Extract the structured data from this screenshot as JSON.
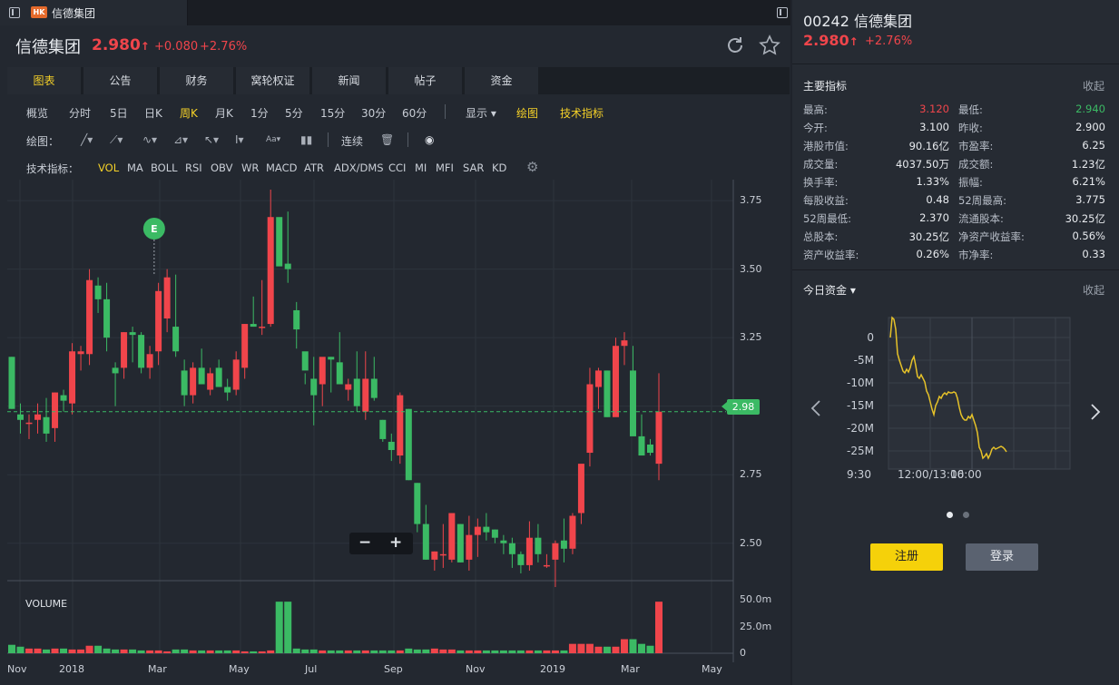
{
  "tab": {
    "badge": "HK",
    "title": "信德集团"
  },
  "header": {
    "name": "信德集团",
    "price": "2.980",
    "arrow": "↑",
    "change": "+0.080",
    "pct": "+2.76%"
  },
  "nav": [
    "图表",
    "公告",
    "财务",
    "窝轮权证",
    "新闻",
    "帖子",
    "资金"
  ],
  "periods": [
    "概览",
    "分时",
    "5日",
    "日K",
    "周K",
    "月K",
    "1分",
    "5分",
    "15分",
    "30分",
    "60分"
  ],
  "period_active": "周K",
  "display_menu": "显示",
  "draw_label": "绘图",
  "tech_label": "技术指标",
  "draw_row": {
    "label": "绘图：",
    "continuous": "连续"
  },
  "indicators_label": "技术指标：",
  "indicators": [
    "VOL",
    "MA",
    "BOLL",
    "RSI",
    "OBV",
    "WR",
    "MACD",
    "ATR",
    "ADX/DMS",
    "CCI",
    "MI",
    "MFI",
    "SAR",
    "KD"
  ],
  "event_marker": "E",
  "last_price_tag": "2.98",
  "volume_label": "VOLUME",
  "chart_data": {
    "type": "candlestick",
    "price_axis": {
      "ticks": [
        "3.75",
        "3.50",
        "3.25",
        "3.00",
        "2.75",
        "2.50"
      ],
      "ylim": [
        2.37,
        3.8
      ]
    },
    "volume_axis": {
      "ticks": [
        "50.0m",
        "25.0m",
        "0"
      ]
    },
    "x_ticks": [
      "Nov",
      "2018",
      "Mar",
      "May",
      "Jul",
      "Sep",
      "Nov",
      "2019",
      "Mar",
      "May"
    ],
    "last_price": 2.98,
    "candles": [
      [
        3.18,
        3.18,
        2.99,
        2.99
      ],
      [
        2.97,
        3.01,
        2.9,
        2.95
      ],
      [
        2.94,
        2.97,
        2.88,
        2.94
      ],
      [
        2.95,
        3.01,
        2.9,
        2.97
      ],
      [
        2.96,
        3.03,
        2.87,
        2.9
      ],
      [
        2.92,
        3.05,
        2.87,
        3.05
      ],
      [
        3.04,
        3.06,
        2.98,
        3.02
      ],
      [
        3.01,
        3.23,
        2.97,
        3.2
      ],
      [
        3.19,
        3.22,
        3.13,
        3.2
      ],
      [
        3.19,
        3.5,
        3.15,
        3.46
      ],
      [
        3.44,
        3.47,
        3.34,
        3.39
      ],
      [
        3.39,
        3.45,
        3.2,
        3.25
      ],
      [
        3.14,
        3.16,
        3.0,
        3.12
      ],
      [
        3.14,
        3.27,
        3.1,
        3.27
      ],
      [
        3.27,
        3.29,
        3.16,
        3.26
      ],
      [
        3.26,
        3.27,
        3.12,
        3.14
      ],
      [
        3.14,
        3.22,
        3.1,
        3.19
      ],
      [
        3.2,
        3.45,
        3.15,
        3.42
      ],
      [
        3.32,
        3.5,
        3.27,
        3.47
      ],
      [
        3.29,
        3.48,
        3.18,
        3.2
      ],
      [
        3.13,
        3.17,
        3.0,
        3.04
      ],
      [
        3.04,
        3.16,
        3.01,
        3.14
      ],
      [
        3.14,
        3.21,
        3.09,
        3.08
      ],
      [
        3.06,
        3.14,
        3.04,
        3.12
      ],
      [
        3.14,
        3.17,
        3.07,
        3.07
      ],
      [
        3.07,
        3.1,
        3.02,
        3.05
      ],
      [
        3.06,
        3.2,
        3.04,
        3.17
      ],
      [
        3.14,
        3.3,
        3.1,
        3.3
      ],
      [
        3.3,
        3.4,
        3.29,
        3.29
      ],
      [
        3.29,
        3.46,
        3.26,
        3.29
      ],
      [
        3.3,
        3.79,
        3.29,
        3.69
      ],
      [
        3.69,
        3.68,
        3.55,
        3.51
      ],
      [
        3.52,
        3.71,
        3.45,
        3.5
      ],
      [
        3.35,
        3.38,
        3.21,
        3.28
      ],
      [
        3.2,
        3.12,
        3.08,
        3.13
      ],
      [
        3.1,
        3.18,
        2.93,
        3.04
      ],
      [
        3.08,
        3.15,
        3.0,
        3.18
      ],
      [
        3.18,
        3.18,
        3.05,
        3.17
      ],
      [
        3.16,
        3.27,
        3.15,
        3.08
      ],
      [
        3.06,
        3.1,
        3.02,
        3.08
      ],
      [
        3.1,
        3.2,
        2.98,
        3.0
      ],
      [
        2.98,
        3.2,
        2.95,
        3.1
      ],
      [
        3.1,
        3.18,
        3.02,
        3.03
      ],
      [
        2.95,
        2.95,
        2.87,
        2.88
      ],
      [
        2.87,
        2.9,
        2.8,
        2.84
      ],
      [
        2.82,
        3.05,
        2.79,
        3.04
      ],
      [
        2.99,
        2.99,
        2.73,
        2.73
      ],
      [
        2.72,
        2.72,
        2.54,
        2.57
      ],
      [
        2.57,
        2.64,
        2.44,
        2.44
      ],
      [
        2.44,
        2.47,
        2.4,
        2.47
      ],
      [
        2.46,
        2.57,
        2.41,
        2.46
      ],
      [
        2.44,
        2.6,
        2.43,
        2.61
      ],
      [
        2.57,
        2.57,
        2.43,
        2.43
      ],
      [
        2.44,
        2.6,
        2.4,
        2.53
      ],
      [
        2.53,
        2.59,
        2.45,
        2.56
      ],
      [
        2.56,
        2.61,
        2.51,
        2.54
      ],
      [
        2.55,
        2.55,
        2.5,
        2.52
      ],
      [
        2.51,
        2.53,
        2.46,
        2.5
      ],
      [
        2.5,
        2.52,
        2.41,
        2.46
      ],
      [
        2.46,
        2.47,
        2.39,
        2.42
      ],
      [
        2.42,
        2.58,
        2.4,
        2.52
      ],
      [
        2.52,
        2.57,
        2.43,
        2.46
      ],
      [
        2.42,
        2.46,
        2.41,
        2.42
      ],
      [
        2.44,
        2.51,
        2.34,
        2.5
      ],
      [
        2.51,
        2.59,
        2.43,
        2.48
      ],
      [
        2.48,
        2.61,
        2.46,
        2.6
      ],
      [
        2.61,
        2.75,
        2.57,
        2.79
      ],
      [
        2.83,
        3.14,
        2.78,
        3.08
      ],
      [
        3.07,
        3.14,
        2.99,
        3.13
      ],
      [
        3.13,
        3.13,
        2.96,
        2.96
      ],
      [
        2.96,
        3.25,
        2.98,
        3.22
      ],
      [
        3.22,
        3.27,
        3.15,
        3.24
      ],
      [
        3.13,
        3.22,
        3.05,
        2.89
      ],
      [
        2.89,
        2.97,
        2.83,
        2.82
      ],
      [
        2.86,
        2.88,
        2.82,
        2.83
      ],
      [
        2.79,
        3.12,
        2.73,
        2.98
      ]
    ],
    "volumes": [
      9,
      7,
      5,
      5,
      4,
      5,
      5,
      4,
      4,
      8,
      8,
      5,
      4,
      4,
      4,
      3,
      3,
      3,
      2,
      4,
      4,
      3,
      3,
      3,
      3,
      3,
      3,
      2,
      2,
      2,
      3,
      55,
      55,
      5,
      4,
      4,
      3,
      3,
      3,
      3,
      3,
      3,
      3,
      3,
      3,
      3,
      5,
      4,
      4,
      5,
      4,
      4,
      3,
      3,
      3,
      3,
      3,
      3,
      3,
      3,
      3,
      3,
      3,
      3,
      3,
      10,
      10,
      10,
      7,
      7,
      7,
      15,
      15,
      10,
      8,
      55
    ]
  },
  "right": {
    "code": "00242",
    "name": "信德集团",
    "price": "2.980",
    "arrow": "↑",
    "pct": "+2.76%",
    "indicators_title": "主要指标",
    "collapse": "收起",
    "stats": [
      {
        "k": "最高:",
        "v": "3.120",
        "c": "#f0454b"
      },
      {
        "k": "最低:",
        "v": "2.940",
        "c": "#3bba64"
      },
      {
        "k": "今开:",
        "v": "3.100",
        "c": ""
      },
      {
        "k": "昨收:",
        "v": "2.900",
        "c": ""
      },
      {
        "k": "港股市值:",
        "v": "90.16亿",
        "c": ""
      },
      {
        "k": "市盈率:",
        "v": "6.25",
        "c": ""
      },
      {
        "k": "成交量:",
        "v": "4037.50万",
        "c": ""
      },
      {
        "k": "成交额:",
        "v": "1.23亿",
        "c": ""
      },
      {
        "k": "换手率:",
        "v": "1.33%",
        "c": ""
      },
      {
        "k": "振幅:",
        "v": "6.21%",
        "c": ""
      },
      {
        "k": "每股收益:",
        "v": "0.48",
        "c": ""
      },
      {
        "k": "52周最高:",
        "v": "3.775",
        "c": ""
      },
      {
        "k": "52周最低:",
        "v": "2.370",
        "c": ""
      },
      {
        "k": "流通股本:",
        "v": "30.25亿",
        "c": ""
      },
      {
        "k": "总股本:",
        "v": "30.25亿",
        "c": ""
      },
      {
        "k": "净资产收益率:",
        "v": "0.56%",
        "c": ""
      },
      {
        "k": "资产收益率:",
        "v": "0.26%",
        "c": ""
      },
      {
        "k": "市净率:",
        "v": "0.33",
        "c": ""
      }
    ],
    "funds_title": "今日资金",
    "funds_collapse": "收起",
    "funds_chart": {
      "y_ticks": [
        "0",
        "-5M",
        "-10M",
        "-15M",
        "-20M",
        "-25M"
      ],
      "x_ticks": [
        "9:30",
        "12:00/13:00",
        "16:00"
      ]
    },
    "register": "注册",
    "login": "登录"
  },
  "colors": {
    "up": "#f0454b",
    "down": "#3bba64",
    "accent": "#f5d128",
    "fund_line": "#e6c229"
  }
}
